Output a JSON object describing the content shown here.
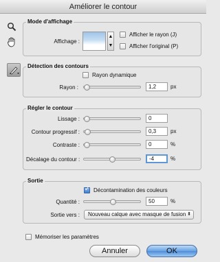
{
  "window": {
    "title": "Améliorer le contour"
  },
  "tools": {
    "zoom_icon": "magnifier-icon",
    "hand_icon": "hand-icon",
    "refine_icon": "refine-radius-brush-icon"
  },
  "mode": {
    "legend": "Mode d'affichage",
    "view_label": "Affichage :",
    "show_radius": "Afficher le rayon (J)",
    "show_original": "Afficher l'original (P)"
  },
  "detection": {
    "legend": "Détection des contours",
    "smart_radius": "Rayon dynamique",
    "radius_label": "Rayon :",
    "radius_value": "1,2",
    "radius_unit": "px"
  },
  "adjust": {
    "legend": "Régler le contour",
    "smooth_label": "Lissage :",
    "smooth_value": "0",
    "feather_label": "Contour progressif :",
    "feather_value": "0,3",
    "feather_unit": "px",
    "contrast_label": "Contraste :",
    "contrast_value": "0",
    "contrast_unit": "%",
    "shift_label": "Décalage du contour :",
    "shift_value": "-4",
    "shift_unit": "%"
  },
  "output": {
    "legend": "Sortie",
    "decontaminate": "Décontamination des couleurs",
    "amount_label": "Quantité :",
    "amount_value": "50",
    "amount_unit": "%",
    "output_to_label": "Sortie vers :",
    "output_to_value": "Nouveau calque avec masque de fusion"
  },
  "remember": "Mémoriser les paramètres",
  "buttons": {
    "cancel": "Annuler",
    "ok": "OK"
  }
}
